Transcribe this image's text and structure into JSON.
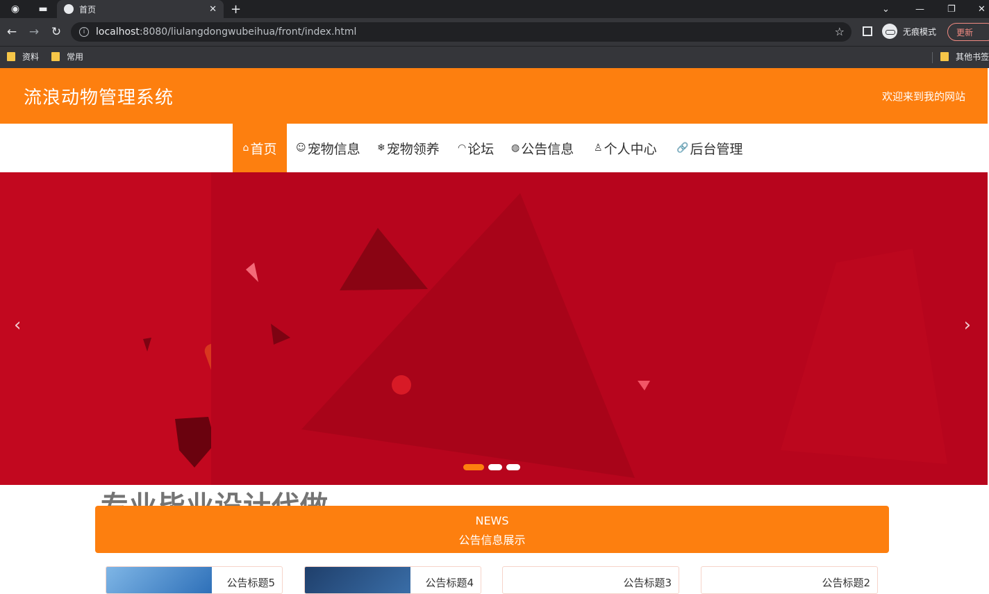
{
  "browser": {
    "tab_title": "首页",
    "url_host": "localhost",
    "url_rest": ":8080/liulangdongwubeihua/front/index.html",
    "profile_label": "无痕模式",
    "update_label": "更新",
    "bookmarks": [
      "资料",
      "常用"
    ],
    "other_bookmarks": "其他书签"
  },
  "header": {
    "site_title": "流浪动物管理系统",
    "welcome": "欢迎来到我的网站"
  },
  "nav": [
    {
      "label": "首页",
      "icon": "home-icon",
      "glyph": "⌂"
    },
    {
      "label": "宠物信息",
      "icon": "pet-icon",
      "glyph": "☺"
    },
    {
      "label": "宠物领养",
      "icon": "snowflake-icon",
      "glyph": "❄"
    },
    {
      "label": "论坛",
      "icon": "dashboard-icon",
      "glyph": "◠"
    },
    {
      "label": "公告信息",
      "icon": "globe-icon",
      "glyph": "◍"
    },
    {
      "label": "个人中心",
      "icon": "user-icon",
      "glyph": "♙"
    },
    {
      "label": "后台管理",
      "icon": "link-icon",
      "glyph": "🔗"
    }
  ],
  "carousel": {
    "prev": "‹",
    "next": "›",
    "slide_count": 3,
    "active_slide": 1
  },
  "watermark": "专业毕业设计代做",
  "news": {
    "title_en": "NEWS",
    "title_cn": "公告信息展示",
    "cards": [
      "公告标题5",
      "公告标题4",
      "公告标题3",
      "公告标题2"
    ]
  },
  "colors": {
    "accent": "#fd7f0f",
    "banner": "#c0081f"
  }
}
